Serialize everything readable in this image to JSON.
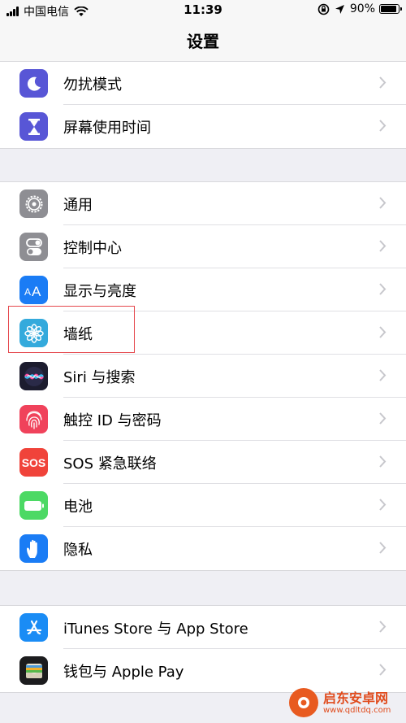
{
  "status_bar": {
    "carrier": "中国电信",
    "time": "11:39",
    "battery_percent": "90%",
    "battery_level": 0.9
  },
  "nav": {
    "title": "设置"
  },
  "group1": [
    {
      "label": "勿扰模式",
      "icon": "moon-icon",
      "color": "#5856d6"
    },
    {
      "label": "屏幕使用时间",
      "icon": "hourglass-icon",
      "color": "#5856d6"
    }
  ],
  "group2": [
    {
      "label": "通用",
      "icon": "gear-icon",
      "color": "#8e8e93"
    },
    {
      "label": "控制中心",
      "icon": "toggles-icon",
      "color": "#8e8e93"
    },
    {
      "label": "显示与亮度",
      "icon": "text-size-icon",
      "color": "#1a7cf5"
    },
    {
      "label": "墙纸",
      "icon": "flower-icon",
      "color": "#34aadc"
    },
    {
      "label": "Siri 与搜索",
      "icon": "siri-icon",
      "color": "#1c1c2e"
    },
    {
      "label": "触控 ID 与密码",
      "icon": "fingerprint-icon",
      "color": "#f0425b"
    },
    {
      "label": "SOS 紧急联络",
      "icon": "sos-icon",
      "icon_text": "SOS",
      "color": "#f0433a"
    },
    {
      "label": "电池",
      "icon": "battery-icon",
      "color": "#4cd964"
    },
    {
      "label": "隐私",
      "icon": "hand-icon",
      "color": "#1a7cf5"
    }
  ],
  "group3": [
    {
      "label": "iTunes Store 与 App Store",
      "icon": "app-store-icon",
      "color": "#1a8cf5"
    },
    {
      "label": "钱包与 Apple Pay",
      "icon": "wallet-icon",
      "color": "#1c1c1e"
    }
  ],
  "watermark": {
    "brand": "启东安卓网",
    "url": "www.qdltdq.com"
  }
}
